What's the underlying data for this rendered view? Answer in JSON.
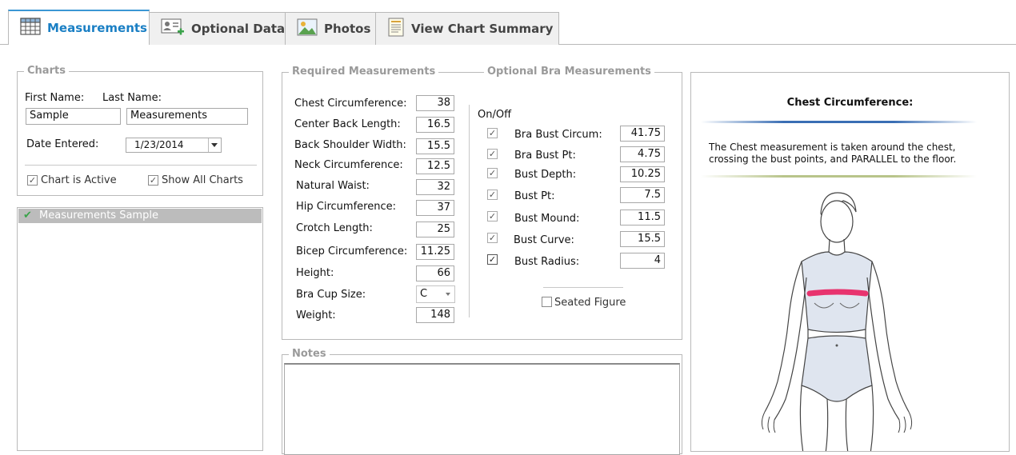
{
  "tabs": [
    {
      "label": "Measurements",
      "icon": "grid-icon",
      "active": true
    },
    {
      "label": "Optional Data",
      "icon": "add-contact-icon",
      "active": false
    },
    {
      "label": "Photos",
      "icon": "image-icon",
      "active": false
    },
    {
      "label": "View Chart Summary",
      "icon": "document-icon",
      "active": false
    }
  ],
  "charts": {
    "legend": "Charts",
    "first_name_label": "First Name:",
    "last_name_label": "Last Name:",
    "first_name_value": "Sample",
    "last_name_value": "Measurements",
    "date_label": "Date Entered:",
    "date_value": "1/23/2014",
    "chart_active_label": "Chart is Active",
    "chart_active_checked": true,
    "show_all_label": "Show All Charts",
    "show_all_checked": true
  },
  "chart_list": [
    {
      "label": "Measurements Sample",
      "selected": true
    }
  ],
  "required": {
    "legend": "Required Measurements",
    "rows": [
      {
        "label": "Chest Circumference:",
        "value": "38"
      },
      {
        "label": "Center Back Length:",
        "value": "16.5"
      },
      {
        "label": "Back Shoulder Width:",
        "value": "15.5"
      },
      {
        "label": "Neck Circumference:",
        "value": "12.5"
      },
      {
        "label": "Natural Waist:",
        "value": "32"
      },
      {
        "label": "Hip Circumference:",
        "value": "37"
      },
      {
        "label": "Crotch Length:",
        "value": "25"
      },
      {
        "label": "Bicep Circumference:",
        "value": "11.25"
      },
      {
        "label": "Height:",
        "value": "66"
      },
      {
        "label": "Bra Cup Size:",
        "value": "C"
      },
      {
        "label": "Weight:",
        "value": "148"
      }
    ]
  },
  "optional": {
    "legend": "Optional Bra Measurements",
    "onoff_label": "On/Off",
    "rows": [
      {
        "label": "Bra Bust Circum:",
        "value": "41.75",
        "checked": true
      },
      {
        "label": "Bra Bust Pt:",
        "value": "4.75",
        "checked": true
      },
      {
        "label": "Bust Depth:",
        "value": "10.25",
        "checked": true
      },
      {
        "label": "Bust Pt:",
        "value": "7.5",
        "checked": true
      },
      {
        "label": "Bust Mound:",
        "value": "11.5",
        "checked": true
      },
      {
        "label": "Bust Curve:",
        "value": "15.5",
        "checked": true
      },
      {
        "label": "Bust Radius:",
        "value": "4",
        "checked": true
      }
    ],
    "seated_label": "Seated Figure",
    "seated_checked": false
  },
  "notes": {
    "legend": "Notes",
    "value": ""
  },
  "help": {
    "title": "Chest Circumference:",
    "line1": "The Chest measurement is taken around the chest,",
    "line2": "crossing the bust points, and PARALLEL to the floor."
  },
  "colors": {
    "accent": "#1a7fc4",
    "highlight_band": "#e8336e",
    "list_selection": "#bcbcbc"
  }
}
